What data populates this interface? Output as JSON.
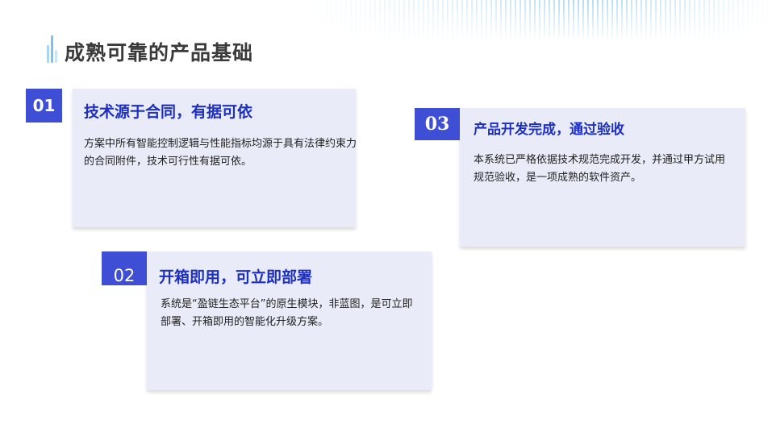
{
  "page": {
    "title": "成熟可靠的产品基础"
  },
  "cards": [
    {
      "number": "01",
      "title": "技术源于合同，有据可依",
      "text": "方案中所有智能控制逻辑与性能指标均源于具有法律约束力的合同附件，技术可行性有据可依。"
    },
    {
      "number": "02",
      "title": "开箱即用，可立即部署",
      "text": "系统是“盈链生态平台”的原生模块，非蓝图，是可立即部署、开箱即用的智能化升级方案。"
    },
    {
      "number": "03",
      "title": "产品开发完成，通过验收",
      "text": "本系统已严格依据技术规范完成开发，并通过甲方试用规范验收，是一项成熟的软件资产。"
    }
  ],
  "colors": {
    "accent": "#3e4fd6",
    "card_title": "#1c2fc0",
    "card_bg": "#e9ebf8",
    "page_title": "#3a3a3a"
  }
}
